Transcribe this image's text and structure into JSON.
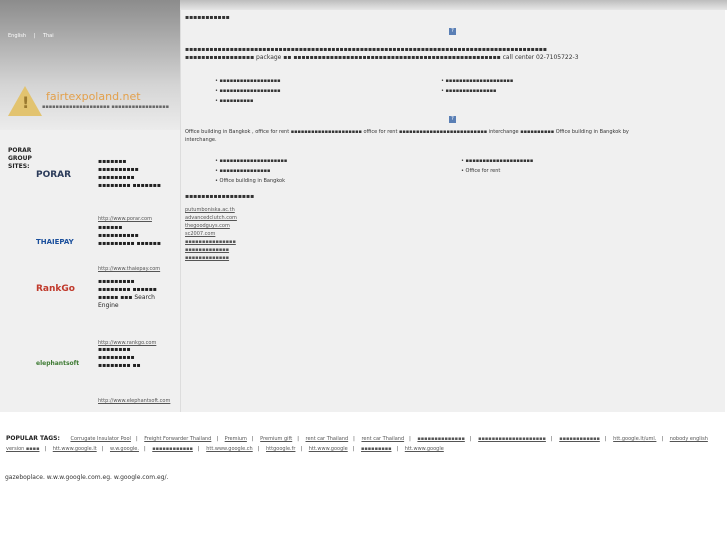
{
  "lang": {
    "english": "English",
    "sep": "|",
    "thai": "Thai"
  },
  "brand": {
    "name": "fairtexpoland.net",
    "tagline": "▪▪▪▪▪▪▪▪▪▪▪▪▪▪▪▪▪▪▪▪ ▪▪▪▪▪▪▪▪▪▪▪▪▪▪▪▪▪"
  },
  "group": {
    "label": "PORAR GROUP SITES:"
  },
  "partners": [
    {
      "logo": "PORAR",
      "desc": "▪▪▪▪▪▪▪ ▪▪▪▪▪▪▪▪▪▪ ▪▪▪▪▪▪▪▪▪ ▪▪▪▪▪▪▪▪ ▪▪▪▪▪▪▪",
      "link": "http://www.porar.com",
      "color": "#2b3b5a"
    },
    {
      "logo": "THAIEPAY",
      "desc": "▪▪▪▪▪▪ ▪▪▪▪▪▪▪▪▪▪ ▪▪▪▪▪▪▪▪▪ ▪▪▪▪▪▪",
      "link": "http://www.thaiepay.com",
      "color": "#1a4f9c"
    },
    {
      "logo": "RankGo",
      "desc": "▪▪▪▪▪▪▪▪▪ ▪▪▪▪▪▪▪▪ ▪▪▪▪▪▪ ▪▪▪▪▪ ▪▪▪ Search Engine",
      "link": "http://www.rankgo.com",
      "color": "#c0392b"
    },
    {
      "logo": "elephantsoft",
      "desc": "▪▪▪▪▪▪▪▪ ▪▪▪▪▪▪▪▪▪ ▪▪▪▪▪▪▪▪ ▪▪",
      "link": "http://www.elephantsoft.com",
      "color": "#3d7a32"
    }
  ],
  "main": {
    "title": "▪▪▪▪▪▪▪▪▪▪▪",
    "para1": "▪▪▪▪▪▪▪▪▪▪▪▪▪▪▪▪▪▪▪▪▪▪▪▪▪▪▪▪▪▪▪▪▪▪▪▪▪▪▪▪▪▪▪▪▪▪▪▪▪▪▪▪▪▪▪▪▪▪▪▪▪▪▪▪▪▪▪▪▪▪▪▪▪▪▪▪▪▪▪▪▪▪▪▪▪▪▪▪▪ ▪▪▪▪▪▪▪▪▪▪▪▪▪▪▪▪▪ package ▪▪ ▪▪▪▪▪▪▪▪▪▪▪▪▪▪▪▪▪▪▪▪▪▪▪▪▪▪▪▪▪▪▪▪▪▪▪▪▪▪▪▪▪▪▪▪▪▪▪▪▪▪▪ call center 02-7105722-3",
    "bullets_left": [
      "▪▪▪▪▪▪▪▪▪▪▪▪▪▪▪▪▪▪",
      "▪▪▪▪▪▪▪▪▪▪▪▪▪▪▪▪▪▪",
      "▪▪▪▪▪▪▪▪▪▪"
    ],
    "bullets_right": [
      "▪▪▪▪▪▪▪▪▪▪▪▪▪▪▪▪▪▪▪▪",
      "▪▪▪▪▪▪▪▪▪▪▪▪▪▪▪"
    ],
    "para2": "Office building in Bangkok , office for rent ▪▪▪▪▪▪▪▪▪▪▪▪▪▪▪▪▪▪▪▪▪ office for rent ▪▪▪▪▪▪▪▪▪▪▪▪▪▪▪▪▪▪▪▪▪▪▪▪▪▪ interchange ▪▪▪▪▪▪▪▪▪▪ Office building in Bangkok by interchange.",
    "bullets2_left": [
      "▪▪▪▪▪▪▪▪▪▪▪▪▪▪▪▪▪▪▪▪",
      "▪▪▪▪▪▪▪▪▪▪▪▪▪▪▪",
      "Office building in Bangkok"
    ],
    "bullets2_right": [
      "▪▪▪▪▪▪▪▪▪▪▪▪▪▪▪▪▪▪▪▪",
      "Office for rent"
    ],
    "heading2": "▪▪▪▪▪▪▪▪▪▪▪▪▪▪▪▪▪",
    "domains": [
      "putumboniska.ac.th",
      "advancedclutch.com",
      "thegoodguys.com",
      "sc2007.com",
      "▪▪▪▪▪▪▪▪▪▪▪▪▪▪▪",
      "▪▪▪▪▪▪▪▪▪▪▪▪▪",
      "▪▪▪▪▪▪▪▪▪▪▪▪▪"
    ]
  },
  "popular": {
    "label": "POPULAR TAGS:",
    "tags": [
      "Corrugate Insulator Pool",
      "Freight Forwarder Thailand",
      "Premium",
      "Premium gift",
      "rent car Thailand",
      "rent car Thailand",
      "▪▪▪▪▪▪▪▪▪▪▪▪▪▪",
      "▪▪▪▪▪▪▪▪▪▪▪▪▪▪▪▪▪▪▪▪",
      "▪▪▪▪▪▪▪▪▪▪▪▪",
      "htt.google.lt/uml.",
      "nobody english version ▪▪▪▪",
      "htt.www.google.lt",
      "w.w.google.",
      "▪▪▪▪▪▪▪▪▪▪▪▪",
      "htt.www.google.ch",
      "httgoogle.fr",
      "htt.www.google",
      "▪▪▪▪▪▪▪▪▪",
      "htt.www.google"
    ]
  },
  "footer": {
    "text": "gazeboplace. w.w.w.google.com.eg. w.google.com.eg/."
  }
}
